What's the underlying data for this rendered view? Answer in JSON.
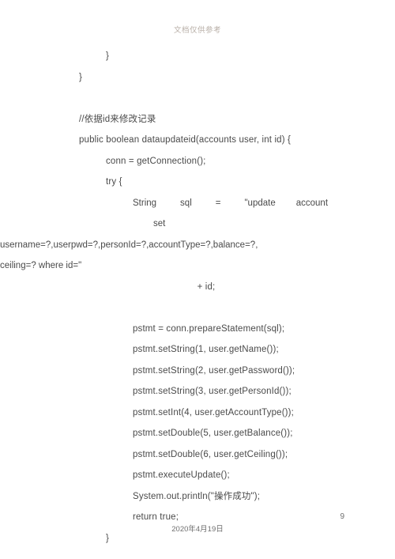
{
  "document": {
    "watermark": "文档仅供参考",
    "footer_date": "2020年4月19日",
    "page_number": "9",
    "lines": [
      {
        "indent": 3,
        "text": "}"
      },
      {
        "indent": 2,
        "text": "}"
      },
      {
        "indent": 0,
        "text": ""
      },
      {
        "indent": 2,
        "text": "//依据id来修改记录"
      },
      {
        "indent": 2,
        "text": "public boolean dataupdateid(accounts user, int id) {"
      },
      {
        "indent": 3,
        "text": "conn = getConnection();"
      },
      {
        "indent": 3,
        "text": "try {"
      },
      {
        "indent": 4,
        "text": "String    sql    =    \"update    account    set username=?,userpwd=?,personId=?,accountType=?,balance=?, ceiling=? where id=\""
      },
      {
        "indent": 5,
        "text": "+ id;"
      },
      {
        "indent": 0,
        "text": ""
      },
      {
        "indent": 4,
        "text": "pstmt = conn.prepareStatement(sql);"
      },
      {
        "indent": 4,
        "text": "pstmt.setString(1, user.getName());"
      },
      {
        "indent": 4,
        "text": "pstmt.setString(2, user.getPassword());"
      },
      {
        "indent": 4,
        "text": "pstmt.setString(3, user.getPersonId());"
      },
      {
        "indent": 4,
        "text": "pstmt.setInt(4, user.getAccountType());"
      },
      {
        "indent": 4,
        "text": "pstmt.setDouble(5, user.getBalance());"
      },
      {
        "indent": 4,
        "text": "pstmt.setDouble(6, user.getCeiling());"
      },
      {
        "indent": 4,
        "text": "pstmt.executeUpdate();"
      },
      {
        "indent": 4,
        "text": "System.out.println(\"操作成功\");"
      },
      {
        "indent": 4,
        "text": "return true;"
      },
      {
        "indent": 3,
        "text": "}"
      }
    ],
    "code_lines": {
      "l0": "}",
      "l1": "}",
      "l2": "//依据id来修改记录",
      "l3": "public boolean dataupdateid(accounts user, int id) {",
      "l4": "conn = getConnection();",
      "l5": "try {",
      "sql_part_a": "String",
      "sql_part_b": "sql",
      "sql_part_c": "=",
      "sql_part_d": "\"update",
      "sql_part_e": "account",
      "sql_part_f": "set",
      "sql_part_g": "username=?,userpwd=?,personId=?,accountType=?,balance=?,",
      "sql_part_h": "ceiling=? where id=\"",
      "sql_plus_id": "+ id;",
      "l6": "pstmt = conn.prepareStatement(sql);",
      "l7": "pstmt.setString(1, user.getName());",
      "l8": "pstmt.setString(2, user.getPassword());",
      "l9": "pstmt.setString(3, user.getPersonId());",
      "l10": "pstmt.setInt(4, user.getAccountType());",
      "l11": "pstmt.setDouble(5, user.getBalance());",
      "l12": "pstmt.setDouble(6, user.getCeiling());",
      "l13": "pstmt.executeUpdate();",
      "l14": "System.out.println(\"操作成功\");",
      "l15": "return true;",
      "l16": "}"
    }
  }
}
